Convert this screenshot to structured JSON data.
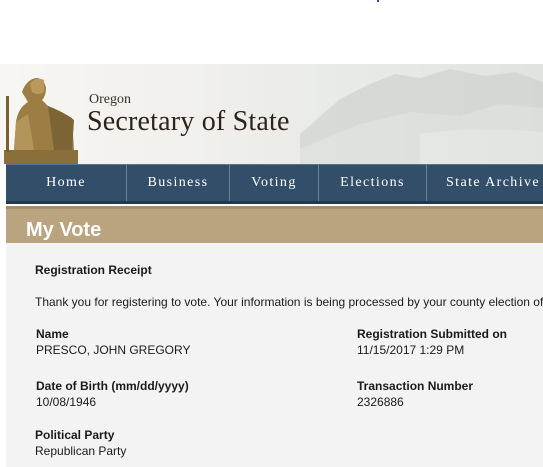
{
  "header": {
    "brand_small": "Oregon",
    "brand_large": "Secretary of State"
  },
  "nav": {
    "items": [
      {
        "label": "Home"
      },
      {
        "label": "Business"
      },
      {
        "label": "Voting"
      },
      {
        "label": "Elections"
      },
      {
        "label": "State Archive"
      }
    ]
  },
  "page": {
    "title": "My Vote"
  },
  "receipt": {
    "heading": "Registration Receipt",
    "message": "Thank you for registering to vote. Your information is being processed by your county election of",
    "fields": {
      "name_label": "Name",
      "name_value": "PRESCO, JOHN GREGORY",
      "submitted_label": "Registration Submitted on",
      "submitted_value": "11/15/2017 1:29 PM",
      "dob_label": "Date of Birth (mm/dd/yyyy)",
      "dob_value": "10/08/1946",
      "txn_label": "Transaction Number",
      "txn_value": "2326886",
      "party_label": "Political Party",
      "party_value": "Republican Party"
    }
  },
  "colors": {
    "nav_bg": "#324e69",
    "title_bar_bg": "#baa480",
    "content_bg": "#f3f3f3"
  },
  "icons": [
    "statue-logo-icon"
  ]
}
